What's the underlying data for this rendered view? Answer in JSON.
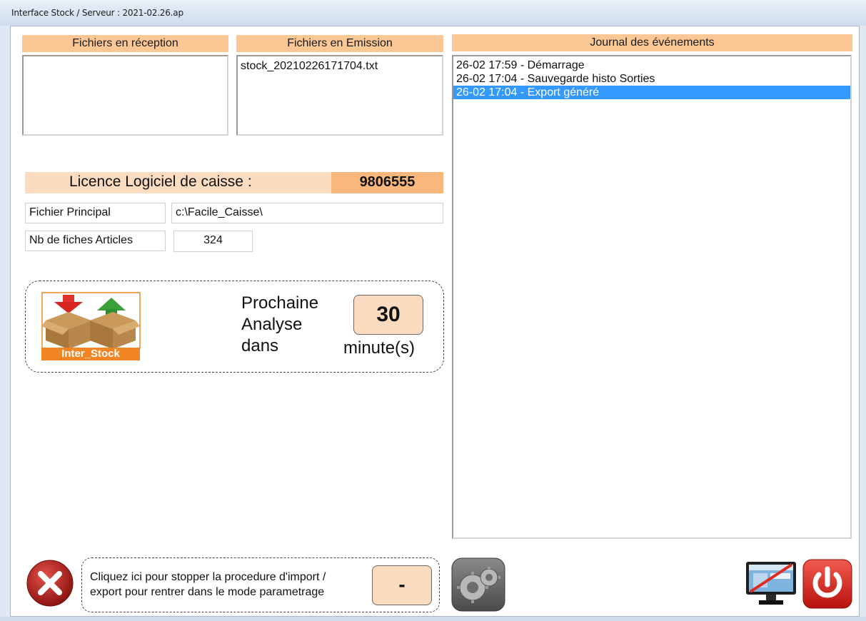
{
  "window": {
    "title": "Interface Stock / Serveur : 2021-02.26.ap"
  },
  "reception": {
    "header": "Fichiers en réception",
    "items": []
  },
  "emission": {
    "header": "Fichiers en Emission",
    "items": [
      "stock_20210226171704.txt"
    ]
  },
  "journal": {
    "header": "Journal des événements",
    "items": [
      {
        "text": "26-02 17:59 - Démarrage",
        "selected": false
      },
      {
        "text": "26-02 17:04 - Sauvegarde histo Sorties",
        "selected": false
      },
      {
        "text": "26-02 17:04 - Export généré",
        "selected": true
      }
    ]
  },
  "licence": {
    "label": "Licence Logiciel de caisse :",
    "value": "9806555"
  },
  "fields": {
    "principal_label": "Fichier Principal",
    "principal_value": "c:\\Facile_Caisse\\",
    "articles_label": "Nb de fiches Articles",
    "articles_value": "324"
  },
  "analysis": {
    "logo_caption": "Inter_Stock",
    "line1": "Prochaine",
    "line2": "Analyse",
    "line3": "dans",
    "counter": "30",
    "unit": "minute(s)"
  },
  "stop": {
    "line1": "Cliquez ici pour stopper la procedure d'import /",
    "line2": "export pour rentrer dans le mode parametrage",
    "value": "-"
  },
  "icons": {
    "stop": "close-circle-icon",
    "settings": "gears-icon",
    "monitor": "monitor-off-icon",
    "power": "power-icon"
  },
  "colors": {
    "header_bg": "#fbc795",
    "selection": "#3399ff",
    "accent_orange": "#f18521",
    "power_red": "#e02a20"
  }
}
